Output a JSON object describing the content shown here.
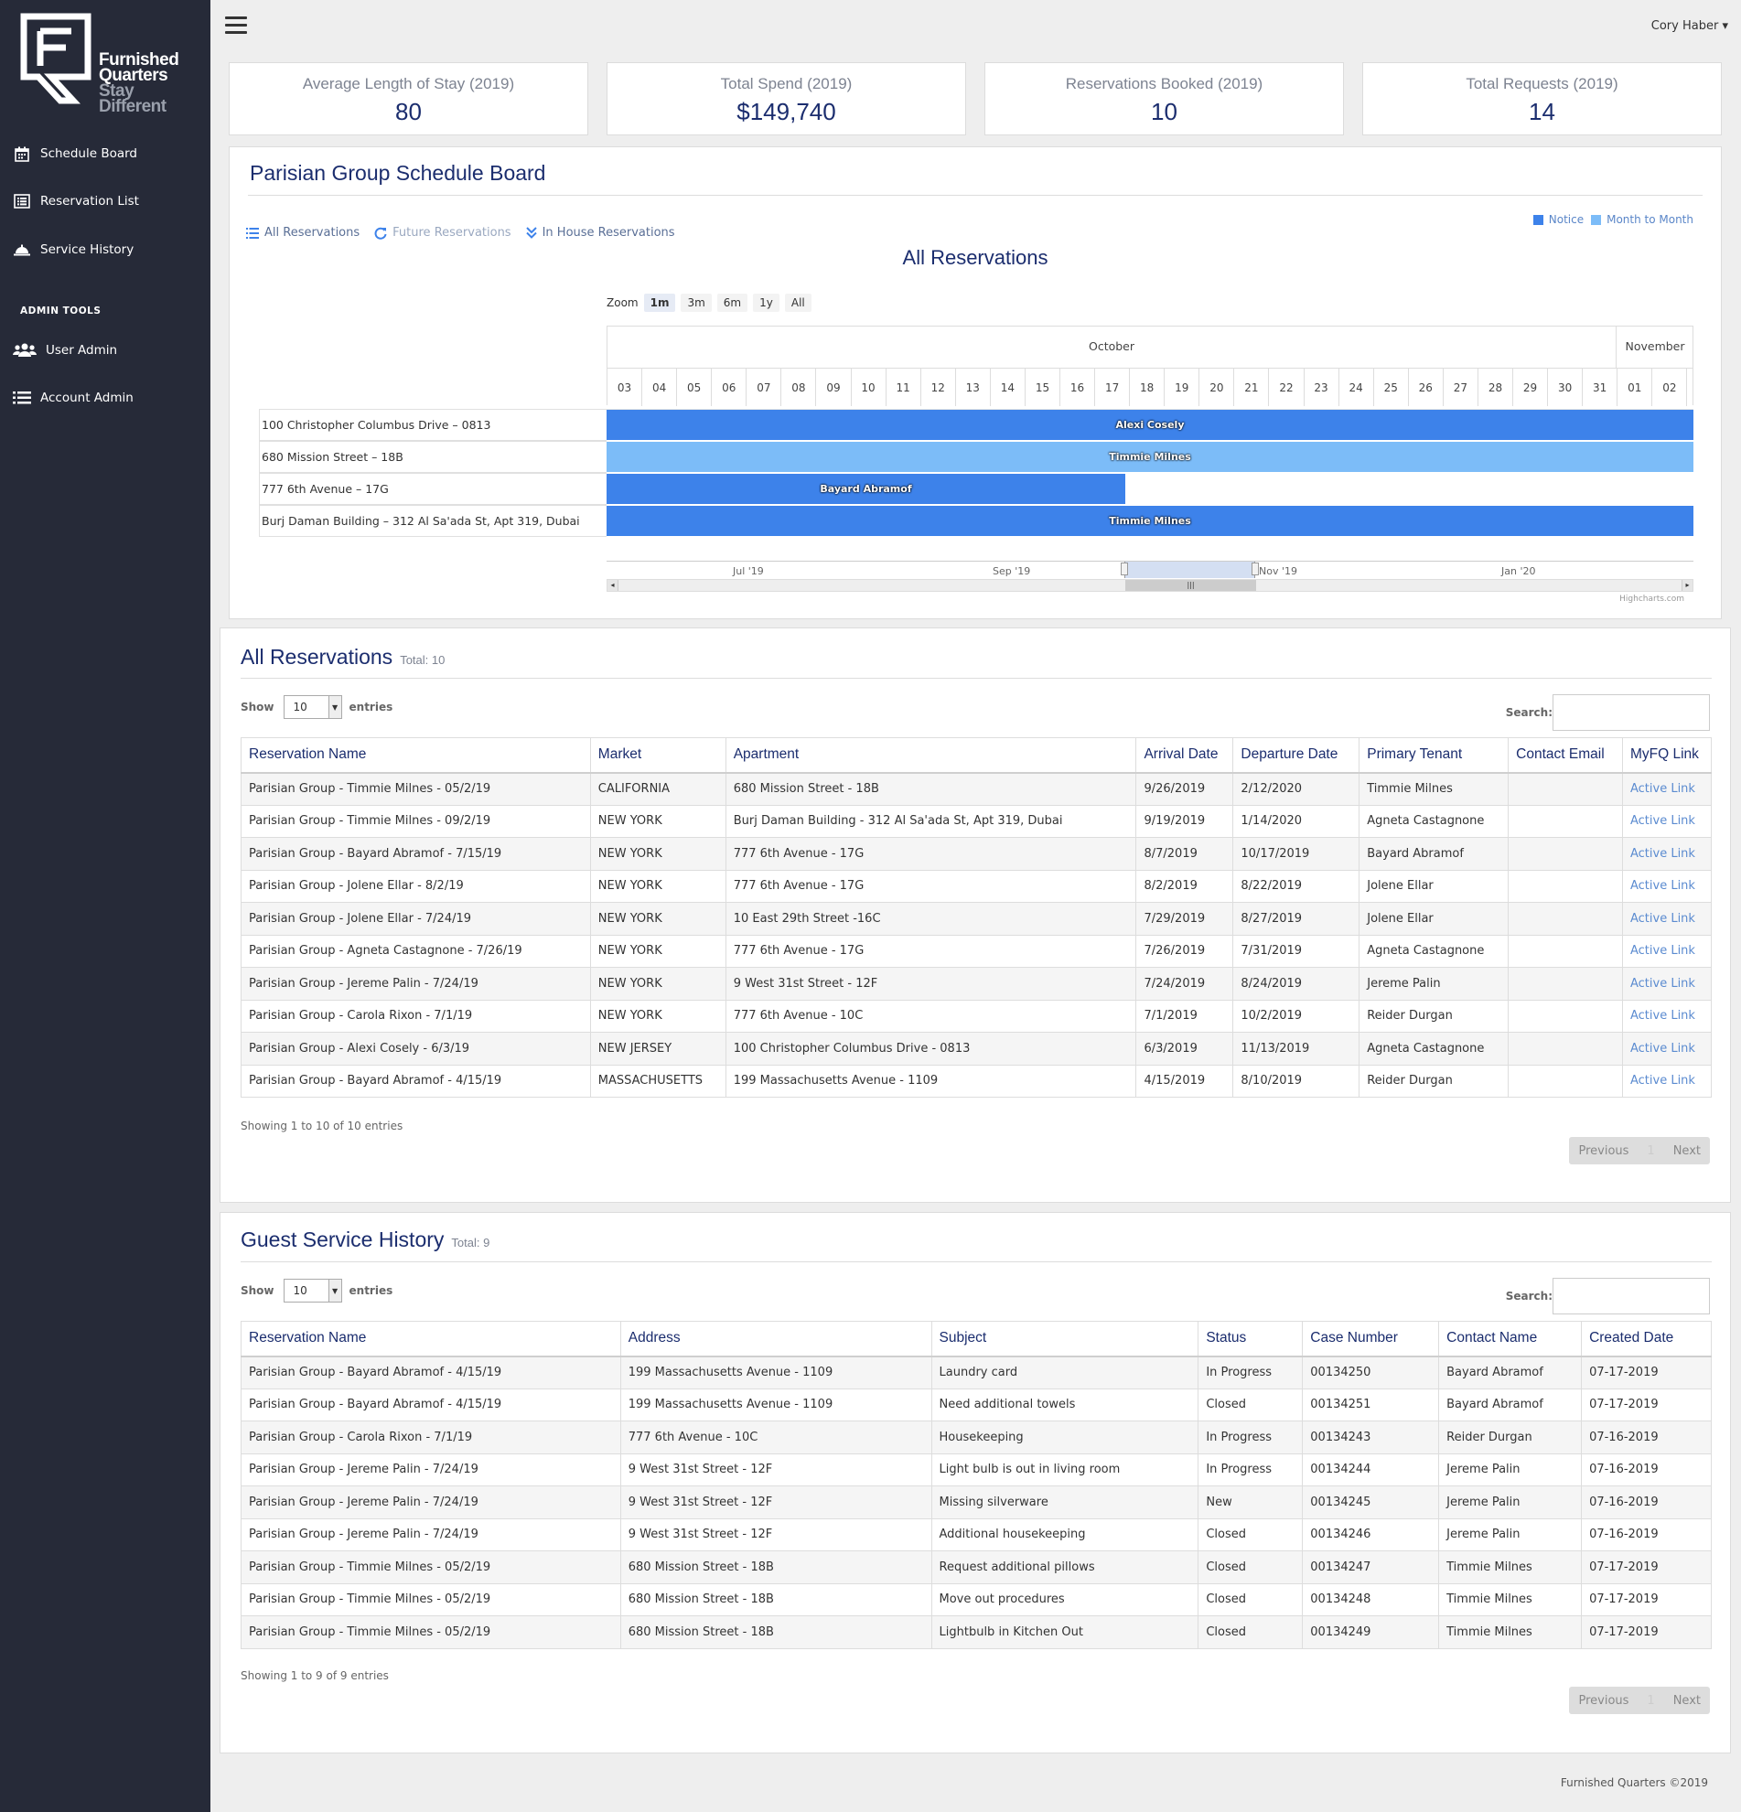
{
  "brand": {
    "line1": "Furnished",
    "line2": "Quarters",
    "line3": "Stay",
    "line4": "Different"
  },
  "sidebar": {
    "items": [
      {
        "label": "Schedule Board",
        "icon": "calendar-icon"
      },
      {
        "label": "Reservation List",
        "icon": "list-icon"
      },
      {
        "label": "Service History",
        "icon": "bell-icon"
      }
    ],
    "admin_heading": "ADMIN TOOLS",
    "admin_items": [
      {
        "label": "User Admin",
        "icon": "users-icon"
      },
      {
        "label": "Account Admin",
        "icon": "list-bullets-icon"
      }
    ]
  },
  "header": {
    "user": "Cory Haber"
  },
  "stats": [
    {
      "label": "Average Length of Stay (2019)",
      "value": "80"
    },
    {
      "label": "Total Spend (2019)",
      "value": "$149,740"
    },
    {
      "label": "Reservations Booked (2019)",
      "value": "10"
    },
    {
      "label": "Total Requests (2019)",
      "value": "14"
    }
  ],
  "schedule": {
    "title": "Parisian Group Schedule Board",
    "tabs": [
      "All Reservations",
      "Future Reservations",
      "In House Reservations"
    ],
    "legend": [
      {
        "label": "Notice",
        "color": "#3d82ea"
      },
      {
        "label": "Month to Month",
        "color": "#7cbcf8"
      }
    ],
    "chart_title": "All Reservations",
    "zoom_label": "Zoom",
    "zoom_buttons": [
      "1m",
      "3m",
      "6m",
      "1y",
      "All"
    ],
    "zoom_selected": "1m",
    "months": [
      "October",
      "November"
    ],
    "days": [
      "03",
      "04",
      "05",
      "06",
      "07",
      "08",
      "09",
      "10",
      "11",
      "12",
      "13",
      "14",
      "15",
      "16",
      "17",
      "18",
      "19",
      "20",
      "21",
      "22",
      "23",
      "24",
      "25",
      "26",
      "27",
      "28",
      "29",
      "30",
      "31",
      "01",
      "02"
    ],
    "rows": [
      {
        "label": "100 Christopher Columbus Drive – 0813",
        "tenant": "Alexi Cosely",
        "type": "Notice",
        "end": "02+"
      },
      {
        "label": "680 Mission Street – 18B",
        "tenant": "Timmie Milnes",
        "type": "Month to Month",
        "end": "02+"
      },
      {
        "label": "777 6th Avenue – 17G",
        "tenant": "Bayard Abramof",
        "type": "Notice",
        "end": "17"
      },
      {
        "label": "Burj Daman Building – 312 Al Sa'ada St, Apt 319, Dubai",
        "tenant": "Timmie Milnes",
        "type": "Notice",
        "end": "02+"
      }
    ],
    "navigator_labels": [
      "Jul '19",
      "Sep '19",
      "Nov '19",
      "Jan '20"
    ],
    "credit": "Highcharts.com"
  },
  "reservations": {
    "title": "All Reservations",
    "total": "Total: 10",
    "show": "Show",
    "entries": "entries",
    "page_size": "10",
    "search": "Search:",
    "columns": [
      "Reservation Name",
      "Market",
      "Apartment",
      "Arrival Date",
      "Departure Date",
      "Primary Tenant",
      "Contact Email",
      "MyFQ Link"
    ],
    "rows": [
      [
        "Parisian Group - Timmie Milnes - 05/2/19",
        "CALIFORNIA",
        "680 Mission Street - 18B",
        "9/26/2019",
        "2/12/2020",
        "Timmie Milnes",
        "",
        "Active Link"
      ],
      [
        "Parisian Group - Timmie Milnes - 09/2/19",
        "NEW YORK",
        "Burj Daman Building - 312 Al Sa'ada St, Apt 319, Dubai",
        "9/19/2019",
        "1/14/2020",
        "Agneta Castagnone",
        "",
        "Active Link"
      ],
      [
        "Parisian Group - Bayard Abramof - 7/15/19",
        "NEW YORK",
        "777 6th Avenue - 17G",
        "8/7/2019",
        "10/17/2019",
        "Bayard Abramof",
        "",
        "Active Link"
      ],
      [
        "Parisian Group - Jolene Ellar - 8/2/19",
        "NEW YORK",
        "777 6th Avenue - 17G",
        "8/2/2019",
        "8/22/2019",
        "Jolene Ellar",
        "",
        "Active Link"
      ],
      [
        "Parisian Group - Jolene Ellar - 7/24/19",
        "NEW YORK",
        "10 East 29th Street -16C",
        "7/29/2019",
        "8/27/2019",
        "Jolene Ellar",
        "",
        "Active Link"
      ],
      [
        "Parisian Group - Agneta Castagnone - 7/26/19",
        "NEW YORK",
        "777 6th Avenue - 17G",
        "7/26/2019",
        "7/31/2019",
        "Agneta Castagnone",
        "",
        "Active Link"
      ],
      [
        "Parisian Group - Jereme Palin - 7/24/19",
        "NEW YORK",
        "9 West 31st Street - 12F",
        "7/24/2019",
        "8/24/2019",
        "Jereme Palin",
        "",
        "Active Link"
      ],
      [
        "Parisian Group - Carola Rixon - 7/1/19",
        "NEW YORK",
        "777 6th Avenue - 10C",
        "7/1/2019",
        "10/2/2019",
        "Reider Durgan",
        "",
        "Active Link"
      ],
      [
        "Parisian Group - Alexi Cosely - 6/3/19",
        "NEW JERSEY",
        "100 Christopher Columbus Drive - 0813",
        "6/3/2019",
        "11/13/2019",
        "Agneta Castagnone",
        "",
        "Active Link"
      ],
      [
        "Parisian Group - Bayard Abramof - 4/15/19",
        "MASSACHUSETTS",
        "199 Massachusetts Avenue - 1109",
        "4/15/2019",
        "8/10/2019",
        "Reider Durgan",
        "",
        "Active Link"
      ]
    ],
    "info": "Showing 1 to 10 of 10 entries",
    "prev": "Previous",
    "page": "1",
    "next": "Next"
  },
  "service": {
    "title": "Guest Service History",
    "total": "Total: 9",
    "show": "Show",
    "entries": "entries",
    "page_size": "10",
    "search": "Search:",
    "columns": [
      "Reservation Name",
      "Address",
      "Subject",
      "Status",
      "Case Number",
      "Contact Name",
      "Created Date"
    ],
    "rows": [
      [
        "Parisian Group - Bayard Abramof - 4/15/19",
        "199 Massachusetts Avenue - 1109",
        "Laundry card",
        "In Progress",
        "00134250",
        "Bayard Abramof",
        "07-17-2019"
      ],
      [
        "Parisian Group - Bayard Abramof - 4/15/19",
        "199 Massachusetts Avenue - 1109",
        "Need additional towels",
        "Closed",
        "00134251",
        "Bayard Abramof",
        "07-17-2019"
      ],
      [
        "Parisian Group - Carola Rixon - 7/1/19",
        "777 6th Avenue - 10C",
        "Housekeeping",
        "In Progress",
        "00134243",
        "Reider Durgan",
        "07-16-2019"
      ],
      [
        "Parisian Group - Jereme Palin - 7/24/19",
        "9 West 31st Street - 12F",
        "Light bulb is out in living room",
        "In Progress",
        "00134244",
        "Jereme Palin",
        "07-16-2019"
      ],
      [
        "Parisian Group - Jereme Palin - 7/24/19",
        "9 West 31st Street - 12F",
        "Missing silverware",
        "New",
        "00134245",
        "Jereme Palin",
        "07-16-2019"
      ],
      [
        "Parisian Group - Jereme Palin - 7/24/19",
        "9 West 31st Street - 12F",
        "Additional housekeeping",
        "Closed",
        "00134246",
        "Jereme Palin",
        "07-16-2019"
      ],
      [
        "Parisian Group - Timmie Milnes - 05/2/19",
        "680 Mission Street - 18B",
        "Request additional pillows",
        "Closed",
        "00134247",
        "Timmie Milnes",
        "07-17-2019"
      ],
      [
        "Parisian Group - Timmie Milnes - 05/2/19",
        "680 Mission Street - 18B",
        "Move out procedures",
        "Closed",
        "00134248",
        "Timmie Milnes",
        "07-17-2019"
      ],
      [
        "Parisian Group - Timmie Milnes - 05/2/19",
        "680 Mission Street - 18B",
        "Lightbulb in Kitchen Out",
        "Closed",
        "00134249",
        "Timmie Milnes",
        "07-17-2019"
      ]
    ],
    "info": "Showing 1 to 9 of 9 entries",
    "prev": "Previous",
    "page": "1",
    "next": "Next"
  },
  "footer": "Furnished Quarters ©2019"
}
